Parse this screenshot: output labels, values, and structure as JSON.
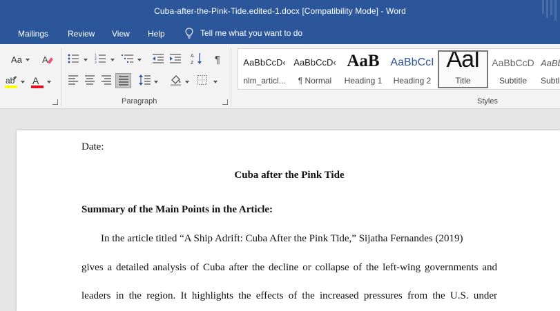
{
  "window": {
    "title": "Cuba-after-the-Pink-Tide.edited-1.docx [Compatibility Mode]  -  Word"
  },
  "menu": {
    "tabs": [
      "Mailings",
      "Review",
      "View",
      "Help"
    ],
    "tell_me": "Tell me what you want to do"
  },
  "ribbon": {
    "font_group": {
      "change_case": "Aa"
    },
    "paragraph_group": {
      "label": "Paragraph"
    },
    "styles_group": {
      "label": "Styles",
      "items": [
        {
          "sample": "AaBbCcD‹",
          "name": "nlm_articl..."
        },
        {
          "sample": "AaBbCcD‹",
          "name": "¶ Normal"
        },
        {
          "sample": "AaB",
          "name": "Heading 1"
        },
        {
          "sample": "AaBbCcI",
          "name": "Heading 2"
        },
        {
          "sample": "AaI",
          "name": "Title"
        },
        {
          "sample": "AaBbCcD",
          "name": "Subtitle"
        },
        {
          "sample": "AaBb",
          "name": "Subtl"
        }
      ]
    }
  },
  "colors": {
    "word_blue": "#2b579a",
    "highlight_yellow": "#ffff00",
    "font_color_red": "#e81123"
  },
  "document": {
    "date_label": "Date:",
    "title": "Cuba after the Pink Tide",
    "section_heading": "Summary of the Main Points in the Article:",
    "paragraph_lines": [
      "In the article titled “A Ship Adrift: Cuba After the Pink Tide,” Sijatha Fernandes (2019)",
      "gives a detailed analysis of Cuba after the decline or collapse of the left-wing governments and",
      "leaders in the region. It highlights the effects of the increased pressures from the U.S. under"
    ]
  }
}
